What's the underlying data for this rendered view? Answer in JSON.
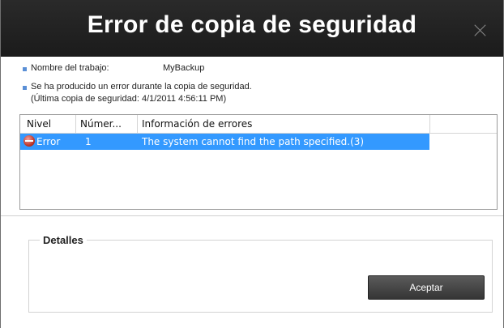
{
  "dialog": {
    "title": "Error de copia de seguridad",
    "close_icon": "close-icon"
  },
  "info": {
    "job_label": "Nombre del trabajo:",
    "job_value": "MyBackup",
    "message_line1": "Se ha producido un error durante la copia de seguridad.",
    "message_line2": "(Última copia de seguridad: 4/1/2011 4:56:11 PM)"
  },
  "list": {
    "columns": [
      "Nivel",
      "Númer...",
      "Información de errores"
    ],
    "rows": [
      {
        "icon": "error-icon",
        "level": "Error",
        "number": "1",
        "info": "The system cannot find the path specified.(3)"
      }
    ]
  },
  "details": {
    "label": "Detalles",
    "ok_button": "Aceptar"
  },
  "colors": {
    "titlebar": "#1f1f1f",
    "selection": "#3399ff",
    "bullet": "#5a8fd6",
    "button": "#464646"
  }
}
